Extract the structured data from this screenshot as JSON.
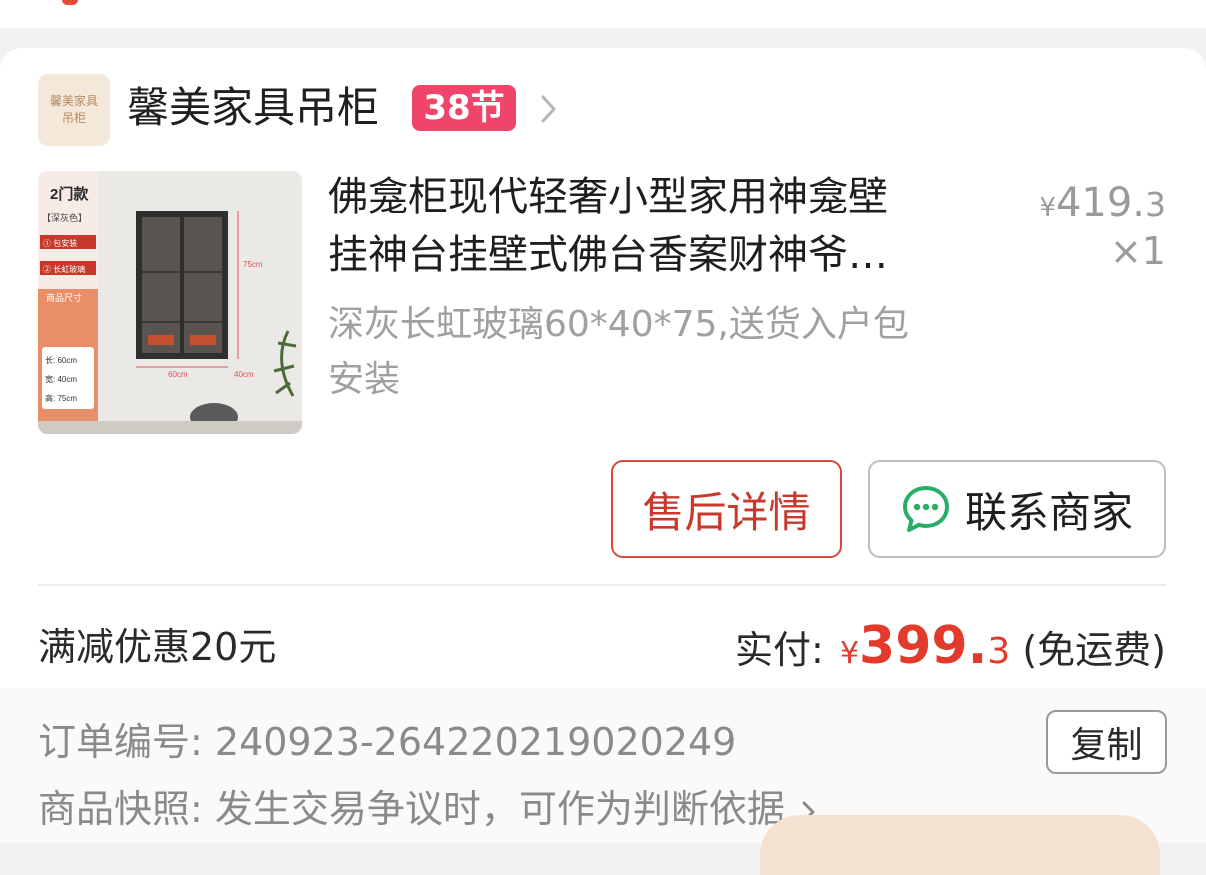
{
  "shop": {
    "logo_text": [
      "馨美家具",
      "吊柜"
    ],
    "name": "馨美家具吊柜",
    "promo_badge": "38节",
    "arrow_icon": "chevron-right-icon"
  },
  "product": {
    "thumb_texts": {
      "label_2door": "2门款",
      "label_color": "【深灰色】",
      "option1": "① 包安装",
      "option2": "② 长虹玻璃",
      "size_title": "商品尺寸",
      "dim_length": "长: 60cm",
      "dim_width": "宽: 40cm",
      "dim_height": "高: 75cm",
      "mark_height": "75cm",
      "mark_width": "60cm",
      "mark_depth": "40cm"
    },
    "title_line1": "佛龛柜现代轻奢小型家用神龛壁",
    "title_line2": "挂神台挂壁式佛台香案财神爷…",
    "sku_line1": "深灰长虹玻璃60*40*75,送货入户包",
    "sku_line2": "安装",
    "unit_price_symbol": "¥",
    "unit_price_int": "419.",
    "unit_price_frac": "3",
    "quantity": "×1"
  },
  "actions": {
    "aftersale_label": "售后详情",
    "contact_label": "联系商家",
    "contact_icon": "chat-bubble-icon"
  },
  "summary": {
    "discount": "满减优惠20元",
    "paid_label": "实付:",
    "paid_symbol": "¥",
    "paid_int": "399.",
    "paid_frac": "3",
    "shipping_note": "(免运费)"
  },
  "order": {
    "number_label": "订单编号:",
    "number_value": "240923-264220219020249",
    "copy_label": "复制",
    "snapshot_label": "商品快照:",
    "snapshot_value": "发生交易争议时，可作为判断依据",
    "snapshot_arrow": "chevron-right-icon"
  },
  "colors": {
    "accent_red": "#e33b2b",
    "promo_pink": "#f0446a",
    "wechat_green": "#2aae67"
  }
}
